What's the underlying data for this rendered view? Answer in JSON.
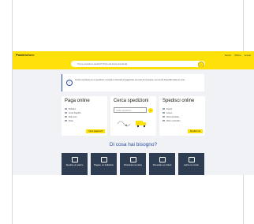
{
  "header": {
    "logo_main": "Poste",
    "logo_sub": "italiane",
    "links": [
      "Servizi",
      "Offerte",
      "Accedi"
    ]
  },
  "search": {
    "placeholder": "Come possiamo aiutarti? Scrivi qui la tua domanda",
    "button_icon": "search-icon"
  },
  "notice": {
    "icon": "info-icon",
    "text": "Avviso importante per le spedizioni: consulta le informazioni aggiornate sui tempi di consegna e sui servizi disponibili nella tua zona."
  },
  "cards": [
    {
      "title": "Paga online",
      "items": [
        "Bollettini",
        "Avvisi PagoPA",
        "Bollo auto",
        "Multe"
      ],
      "cta": "Vai ai pagamenti"
    },
    {
      "title": "Cerca spedizioni",
      "placeholder": "Codice spedizione",
      "cta": ""
    },
    {
      "title": "Spedisci online",
      "items": [
        "Pacchi",
        "Lettere",
        "Raccomandate",
        "Ritiro a domicilio"
      ],
      "cta": "Spedisci ora"
    }
  ],
  "section_title": "Di cosa hai bisogno?",
  "tiles": [
    {
      "label": "Spedire un pacco",
      "icon": "box-icon"
    },
    {
      "label": "Pagare un bollettino",
      "icon": "receipt-icon"
    },
    {
      "label": "Ricaricare la carta",
      "icon": "card-icon"
    },
    {
      "label": "Prenotare un ticket",
      "icon": "ticket-icon"
    },
    {
      "label": "Aprire un conto",
      "icon": "account-icon"
    }
  ]
}
